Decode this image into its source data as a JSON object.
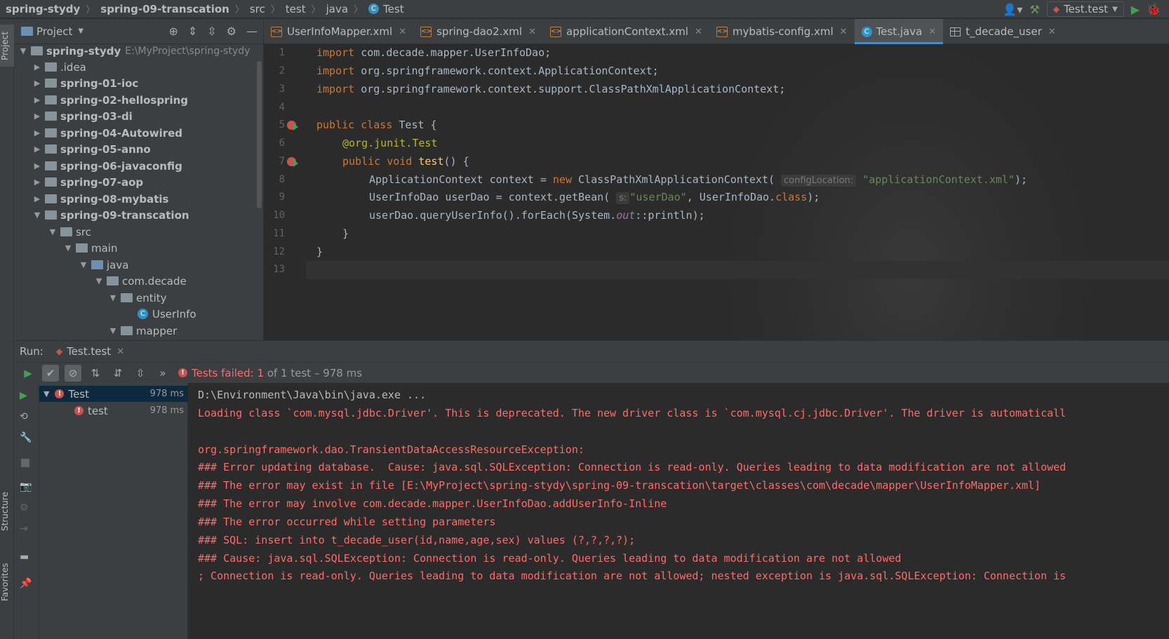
{
  "breadcrumb": {
    "project": "spring-stydy",
    "module": "spring-09-transcation",
    "src": "src",
    "test": "test",
    "java": "java",
    "file": "Test"
  },
  "run_config": "Test.test",
  "left_strip": {
    "project_label": "Project",
    "structure_label": "Structure",
    "favorites_label": "Favorites"
  },
  "project_panel": {
    "title": "Project",
    "root": {
      "name": "spring-stydy",
      "path": "E:\\MyProject\\spring-stydy"
    },
    "items": [
      {
        "label": ".idea"
      },
      {
        "label": "spring-01-ioc"
      },
      {
        "label": "spring-02-hellospring"
      },
      {
        "label": "spring-03-di"
      },
      {
        "label": "spring-04-Autowired"
      },
      {
        "label": "spring-05-anno"
      },
      {
        "label": "spring-06-javaconfig"
      },
      {
        "label": "spring-07-aop"
      },
      {
        "label": "spring-08-mybatis"
      },
      {
        "label": "spring-09-transcation"
      },
      {
        "label": "src"
      },
      {
        "label": "main"
      },
      {
        "label": "java"
      },
      {
        "label": "com.decade"
      },
      {
        "label": "entity"
      },
      {
        "label": "UserInfo"
      },
      {
        "label": "mapper"
      }
    ]
  },
  "tabs": [
    {
      "label": "UserInfoMapper.xml"
    },
    {
      "label": "spring-dao2.xml"
    },
    {
      "label": "applicationContext.xml"
    },
    {
      "label": "mybatis-config.xml"
    },
    {
      "label": "Test.java"
    },
    {
      "label": "t_decade_user"
    }
  ],
  "editor": {
    "line_numbers": [
      "1",
      "2",
      "3",
      "4",
      "5",
      "6",
      "7",
      "8",
      "9",
      "10",
      "11",
      "12",
      "13"
    ],
    "code": {
      "l1_kw": "import",
      "l1_rest": " com.decade.mapper.UserInfoDao;",
      "l2_kw": "import",
      "l2_rest": " org.springframework.context.ApplicationContext;",
      "l3_kw": "import",
      "l3_rest": " org.springframework.context.support.ClassPathXmlApplicationContext;",
      "l5_kw": "public class",
      "l5_rest": " Test {",
      "l6_at": "@org.junit.",
      "l6_ann": "Test",
      "l7_kw": "public void",
      "l7_fn": "test",
      "l7_rest": "() {",
      "l8_a": "ApplicationContext context = ",
      "l8_new": "new",
      "l8_b": " ClassPathXmlApplicationContext( ",
      "l8_hint": "configLocation:",
      "l8_str": "\"applicationContext.xml\"",
      "l8_c": ");",
      "l9_a": "UserInfoDao userDao = context.getBean( ",
      "l9_hint": "s:",
      "l9_str": "\"userDao\"",
      "l9_b": ", UserInfoDao.",
      "l9_kw": "class",
      "l9_c": ");",
      "l10_a": "userDao.queryUserInfo().forEach(System.",
      "l10_it": "out",
      "l10_b": "::println);",
      "l11": "}",
      "l12": "}"
    }
  },
  "run": {
    "label": "Run:",
    "tab": "Test.test",
    "status_prefix": "Tests failed: ",
    "failed_count": "1",
    "status_suffix": " of 1 test – 978 ms",
    "tests": [
      {
        "name": "Test",
        "time": "978 ms"
      },
      {
        "name": "test",
        "time": "978 ms"
      }
    ]
  },
  "console": {
    "lines": [
      "D:\\Environment\\Java\\bin\\java.exe ...",
      "Loading class `com.mysql.jdbc.Driver'. This is deprecated. The new driver class is `com.mysql.cj.jdbc.Driver'. The driver is automaticall",
      "",
      "org.springframework.dao.TransientDataAccessResourceException:",
      "### Error updating database.  Cause: java.sql.SQLException: Connection is read-only. Queries leading to data modification are not allowed",
      "### The error may exist in file [E:\\MyProject\\spring-stydy\\spring-09-transcation\\target\\classes\\com\\decade\\mapper\\UserInfoMapper.xml]",
      "### The error may involve com.decade.mapper.UserInfoDao.addUserInfo-Inline",
      "### The error occurred while setting parameters",
      "### SQL: insert into t_decade_user(id,name,age,sex) values (?,?,?,?);",
      "### Cause: java.sql.SQLException: Connection is read-only. Queries leading to data modification are not allowed",
      "; Connection is read-only. Queries leading to data modification are not allowed; nested exception is java.sql.SQLException: Connection is"
    ]
  },
  "colors": {
    "accent": "#4a88c7",
    "error": "#c75450",
    "console_error": "#ff6b68",
    "run_green": "#499c54"
  }
}
